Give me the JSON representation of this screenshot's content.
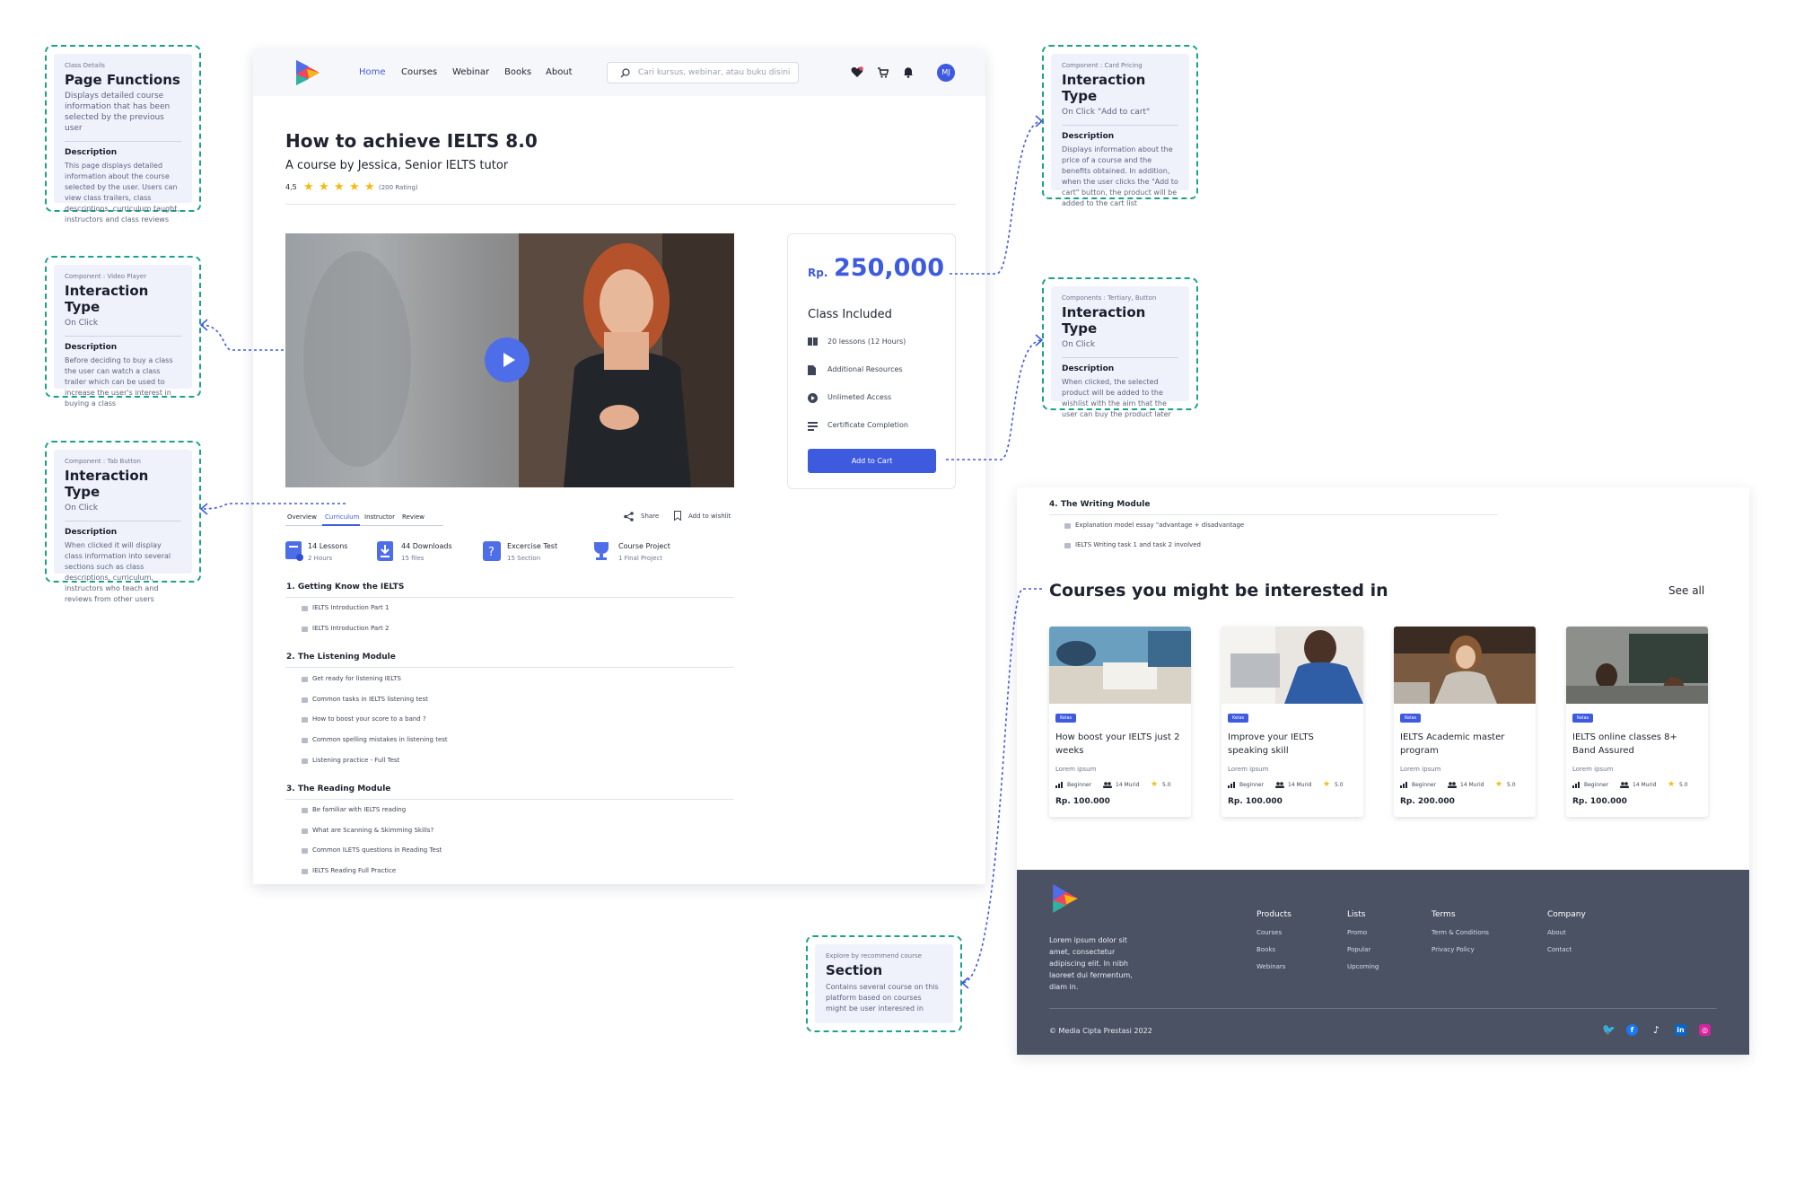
{
  "annotations": {
    "page_functions": {
      "subtitle": "Class Details",
      "title": "Page Functions",
      "value": "Displays detailed course information that has been selected by the previous user",
      "desc_heading": "Description",
      "desc": "This page displays detailed information about the course selected by the user. Users can view class trailers, class descriptions, curriculum taught, instructors and class reviews"
    },
    "video_player": {
      "subtitle": "Component : Video Player",
      "title": "Interaction Type",
      "value": "On Click",
      "desc_heading": "Description",
      "desc": "Before deciding to buy a class the user can watch a class trailer which can be used to increase the user's interest in buying a class"
    },
    "tab_button": {
      "subtitle": "Component : Tab Button",
      "title": "Interaction Type",
      "value": "On Click",
      "desc_heading": "Description",
      "desc": "When clicked it will display class information into several sections such as class descriptions, curriculum, instructors who teach and reviews from other users"
    },
    "card_pricing": {
      "subtitle": "Component : Card Pricing",
      "title": "Interaction Type",
      "value": "On Click \"Add to cart\"",
      "desc_heading": "Description",
      "desc": "Displays information about the price of a course and the benefits obtained. In addition, when the user clicks the \"Add to cart\" button, the product will be added to the cart list"
    },
    "tertiary_button": {
      "subtitle": "Components : Tertiary, Button",
      "title": "Interaction Type",
      "value": "On Click",
      "desc_heading": "Description",
      "desc": "When clicked, the selected product will be added to the wishlist with the aim that the user can buy the product later"
    },
    "recommend_section": {
      "subtitle": "Explore by recommend course",
      "title": "Section",
      "desc": "Contains several course on this platform based on courses might be user interesred in"
    }
  },
  "nav": {
    "links": [
      "Home",
      "Courses",
      "Webinar",
      "Books",
      "About"
    ],
    "search_placeholder": "Cari kursus, webinar, atau buku disini",
    "avatar": "MJ"
  },
  "course": {
    "title": "How to achieve IELTS 8.0",
    "byline": "A course by Jessica, Senior IELTS tutor",
    "rating": "4,5",
    "rating_count": "(200 Rating)"
  },
  "pricing": {
    "currency": "Rp.",
    "amount": "250,000",
    "included_title": "Class Included",
    "items": [
      "20 lessons (12 Hours)",
      "Additional Resources",
      "Unlimeted Access",
      "Certificate Completion"
    ],
    "button": "Add to Cart"
  },
  "tabs": [
    "Overview",
    "Curriculum",
    "Instructor",
    "Review"
  ],
  "actions": {
    "share": "Share",
    "wishlist": "Add to wishlit"
  },
  "stats": [
    {
      "title": "14 Lessons",
      "sub": "2 Hours"
    },
    {
      "title": "44 Downloads",
      "sub": "15 files"
    },
    {
      "title": "Excercise Test",
      "sub": "15 Section"
    },
    {
      "title": "Course Project",
      "sub": "1 Final Project"
    }
  ],
  "modules": [
    {
      "title": "1. Getting Know the IELTS",
      "lessons": [
        "IELTS Introduction Part 1",
        "IELTS Introduction Part 2"
      ]
    },
    {
      "title": "2.  The Listening Module",
      "lessons": [
        "Get ready for listening IELTS",
        "Common tasks in IELTS listening test",
        "How to boost your score to a band ?",
        "Common spelling mistakes in listening test",
        "Listening practice - Full Test"
      ]
    },
    {
      "title": "3.  The Reading Module",
      "lessons": [
        "Be familiar with IELTS reading",
        "What are Scanning & Skimming Skills?",
        "Common ILETS questions in Reading Test",
        "IELTS Reading Full Practice"
      ]
    }
  ],
  "writing_module": {
    "title": "4.  The Writing Module",
    "lessons": [
      "Explanation model essay \"advantage + disadvantage",
      "IELTS Writing task 1 and task 2 involved"
    ]
  },
  "recommend": {
    "title": "Courses you might be interested in",
    "see_all": "See all",
    "cards": [
      {
        "badge": "Kelas",
        "title": "How boost your IELTS just 2 weeks",
        "lorem": "Lorem ipsum",
        "level": "Beginner",
        "students": "14 Murid",
        "score": "5.0",
        "price": "Rp. 100.000"
      },
      {
        "badge": "Kelas",
        "title": "Improve your IELTS speaking skill",
        "lorem": "Lorem ipsum",
        "level": "Beginner",
        "students": "14 Murid",
        "score": "5.0",
        "price": "Rp. 100.000"
      },
      {
        "badge": "Kelas",
        "title": "IELTS Academic master program",
        "lorem": "Lorem ipsum",
        "level": "Beginner",
        "students": "14 Murid",
        "score": "5.0",
        "price": "Rp. 200.000"
      },
      {
        "badge": "Kelas",
        "title": "IELTS online classes 8+ Band Assured",
        "lorem": "Lorem ipsum",
        "level": "Beginner",
        "students": "14 Murid",
        "score": "5.0",
        "price": "Rp. 100.000"
      }
    ]
  },
  "footer": {
    "desc": "Lorem ipsum dolor sit amet, consectetur adipiscing elit. In nibh laoreet dui fermentum, diam in.",
    "columns": [
      {
        "title": "Products",
        "links": [
          "Courses",
          "Books",
          "Webinars"
        ]
      },
      {
        "title": "Lists",
        "links": [
          "Promo",
          "Popular",
          "Upcoming"
        ]
      },
      {
        "title": "Terms",
        "links": [
          "Term & Conditions",
          "Privacy Policy"
        ]
      },
      {
        "title": "Company",
        "links": [
          "About",
          "Contact"
        ]
      }
    ],
    "copyright": "© Media Cipta Prestasi 2022",
    "social_icons": [
      "twitter-icon",
      "facebook-icon",
      "tiktok-icon",
      "linkedin-icon",
      "instagram-icon"
    ]
  },
  "colors": {
    "accent": "#3e5be0",
    "annotation_border": "#19a38a",
    "footer_bg": "#4a5264",
    "star": "#f6b90e"
  }
}
